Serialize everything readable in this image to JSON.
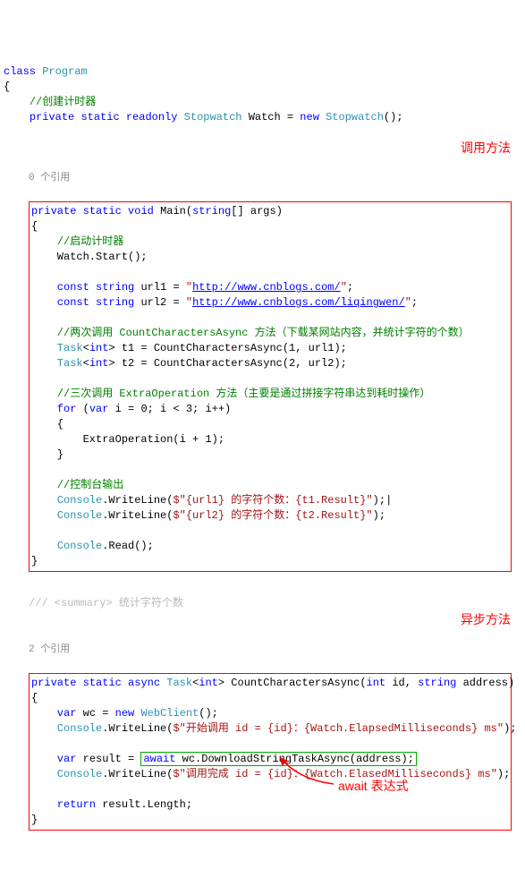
{
  "header": {
    "l1_a": "class",
    "l1_b": "Program",
    "l2": "{",
    "c1": "//创建计时器",
    "l3_a": "private",
    "l3_b": "static",
    "l3_c": "readonly",
    "l3_d": "Stopwatch",
    "l3_e": "Watch = ",
    "l3_f": "new",
    "l3_g": "Stopwatch",
    "l3_h": "();"
  },
  "label1": "调用方法",
  "ref1": "0 个引用",
  "main": {
    "sig_a": "private",
    "sig_b": "static",
    "sig_c": "void",
    "sig_d": "Main(",
    "sig_e": "string",
    "sig_f": "[] args)",
    "ob": "{",
    "c_start": "//启动计时器",
    "start": "    Watch.Start();",
    "l_u1a": "    const",
    "l_u1b": "string",
    "l_u1c": "url1 = ",
    "l_u1q1": "\"",
    "l_u1u": "http://www.cnblogs.com/",
    "l_u1q2": "\"",
    "l_u1s": ";",
    "l_u2a": "    const",
    "l_u2b": "string",
    "l_u2c": "url2 = ",
    "l_u2q1": "\"",
    "l_u2u": "http://www.cnblogs.com/liqingwen/",
    "l_u2q2": "\"",
    "l_u2s": ";",
    "c_cc": "    //两次调用 CountCharactersAsync 方法（下载某网站内容，并统计字符的个数）",
    "t1a": "    Task",
    "t1b": "<",
    "t1c": "int",
    "t1d": "> t1 = CountCharactersAsync(1, url1);",
    "t2a": "    Task",
    "t2b": "<",
    "t2c": "int",
    "t2d": "> t2 = CountCharactersAsync(2, url2);",
    "c_ex": "    //三次调用 ExtraOperation 方法（主要是通过拼接字符串达到耗时操作）",
    "for_a": "    for",
    "for_b": "(",
    "for_c": "var",
    "for_d": "i = 0; i < 3; i++)",
    "fob": "    {",
    "fbody": "        ExtraOperation(i + 1);",
    "fcb": "    }",
    "c_out": "    //控制台输出",
    "w1a": "    Console",
    "w1b": ".WriteLine(",
    "w1s": "$\"{url1} 的字符个数：{t1.Result}\"",
    "w1e": ");",
    "w1cur": "|",
    "w2a": "    Console",
    "w2b": ".WriteLine(",
    "w2s": "$\"{url2} 的字符个数：{t2.Result}\"",
    "w2e": ");",
    "read_a": "    Console",
    "read_b": ".Read();",
    "cb": "}"
  },
  "summary": "/// <summary> 统计字符个数",
  "ref2": "2 个引用",
  "label2": "异步方法",
  "async": {
    "sig_a": "private",
    "sig_b": "static",
    "sig_c": "async",
    "sig_d": "Task",
    "sig_lt": "<",
    "sig_e": "int",
    "sig_gt": "> CountCharactersAsync(",
    "sig_f": "int",
    "sig_g": " id, ",
    "sig_h": "string",
    "sig_i": " address)",
    "ob": "{",
    "wc_a": "    var",
    "wc_b": "wc = ",
    "wc_c": "new",
    "wc_d": "WebClient",
    "wc_e": "();",
    "w1a": "    Console",
    "w1b": ".WriteLine(",
    "w1s": "$\"开始调用 id = {id}：{Watch.ElapsedMilliseconds} ms\"",
    "w1e": ");",
    "res_a": "    var",
    "res_b": "result = ",
    "res_c": "await",
    "res_d": "wc.DownloadStringTaskAsync(address);",
    "w2a": "    Console",
    "w2b": ".WriteLine(",
    "w2s": "$\"调用完成 id = {id}：{Watch.Ela",
    "w2s2": "sedMilliseconds} ms\"",
    "w2e": ");",
    "ret_a": "    return",
    "ret_b": "result.Length;",
    "cb": "}"
  },
  "caption_await": "await 表达式"
}
